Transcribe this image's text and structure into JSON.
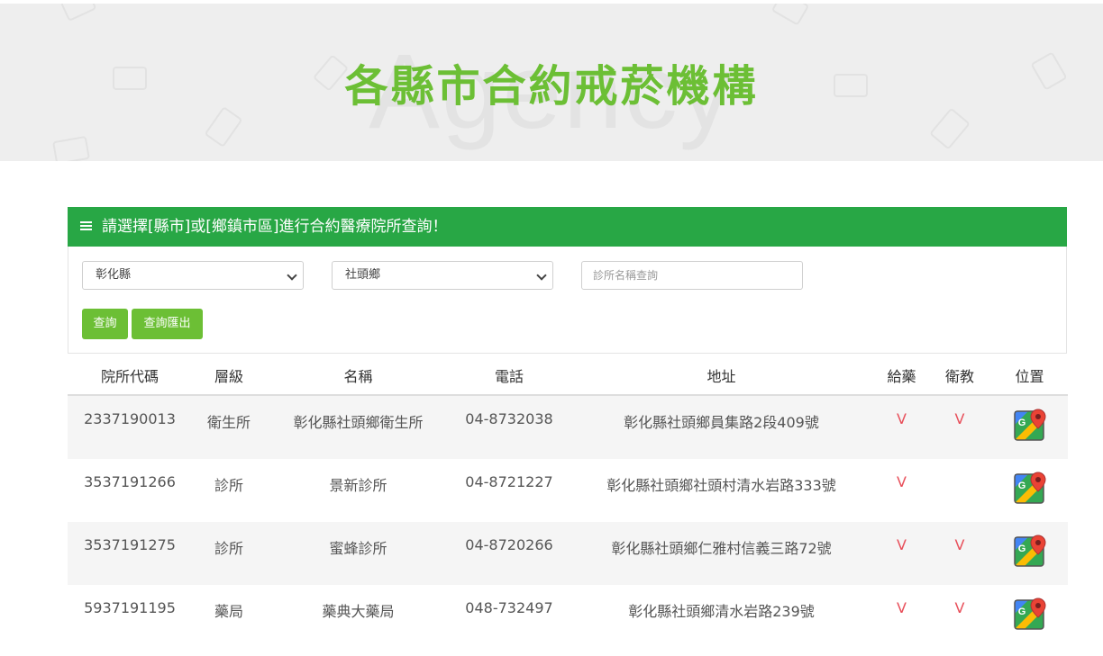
{
  "hero": {
    "title": "各縣市合約戒菸機構",
    "watermark": "Agency"
  },
  "search_panel": {
    "heading": "請選擇[縣市]或[鄉鎮市區]進行合約醫療院所查詢！",
    "county_select": "彰化縣",
    "district_select": "社頭鄉",
    "name_input_placeholder": "診所名稱查詢",
    "query_button": "查詢",
    "export_button": "查詢匯出"
  },
  "table": {
    "headers": [
      "院所代碼",
      "層級",
      "名稱",
      "電話",
      "地址",
      "給藥",
      "衛教",
      "位置"
    ],
    "rows": [
      {
        "code": "2337190013",
        "level": "衛生所",
        "name": "彰化縣社頭鄉衛生所",
        "phone": "04-8732038",
        "address": "彰化縣社頭鄉員集路2段409號",
        "medication": "V",
        "education": "V"
      },
      {
        "code": "3537191266",
        "level": "診所",
        "name": "景新診所",
        "phone": "04-8721227",
        "address": "彰化縣社頭鄉社頭村清水岩路333號",
        "medication": "V",
        "education": ""
      },
      {
        "code": "3537191275",
        "level": "診所",
        "name": "蜜蜂診所",
        "phone": "04-8720266",
        "address": "彰化縣社頭鄉仁雅村信義三路72號",
        "medication": "V",
        "education": "V"
      },
      {
        "code": "5937191195",
        "level": "藥局",
        "name": "藥典大藥局",
        "phone": "048-732497",
        "address": "彰化縣社頭鄉清水岩路239號",
        "medication": "V",
        "education": "V"
      }
    ]
  },
  "icons": {
    "panel_heading": "list-icon",
    "location": "google-maps-icon",
    "select": "chevron-down-icon"
  },
  "colors": {
    "brand_green": "#6cbf35",
    "panel_green": "#28a745",
    "check_red": "#e8505b"
  }
}
